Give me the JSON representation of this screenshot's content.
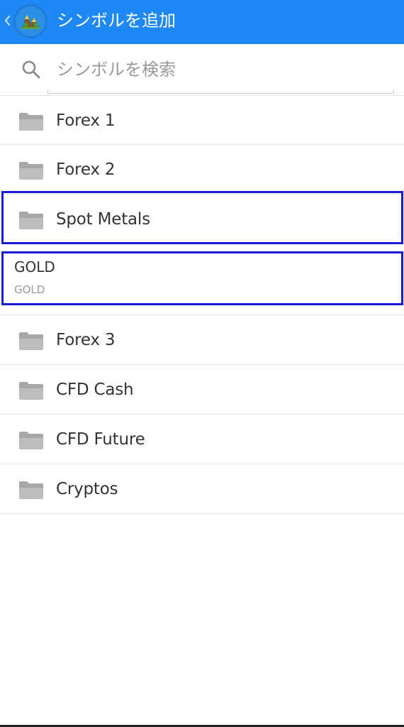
{
  "appbar": {
    "title": "シンボルを追加",
    "back_icon": "chevron-left-icon",
    "logo_icon": "metatrader-logo-icon",
    "background_color": "#1e88f5"
  },
  "search": {
    "placeholder": "シンボルを検索",
    "value": "",
    "icon": "search-icon"
  },
  "groups": [
    {
      "label": "Forex 1",
      "icon": "folder-icon"
    },
    {
      "label": "Forex 2",
      "icon": "folder-icon"
    },
    {
      "label": "Spot Metals",
      "icon": "folder-icon"
    }
  ],
  "symbol": {
    "name": "GOLD",
    "description": "GOLD"
  },
  "groups_after": [
    {
      "label": "Forex 3",
      "icon": "folder-icon"
    },
    {
      "label": "CFD Cash",
      "icon": "folder-icon"
    },
    {
      "label": "CFD Future",
      "icon": "folder-icon"
    },
    {
      "label": "Cryptos",
      "icon": "folder-icon"
    }
  ],
  "highlight_color": "#1a1ad6"
}
